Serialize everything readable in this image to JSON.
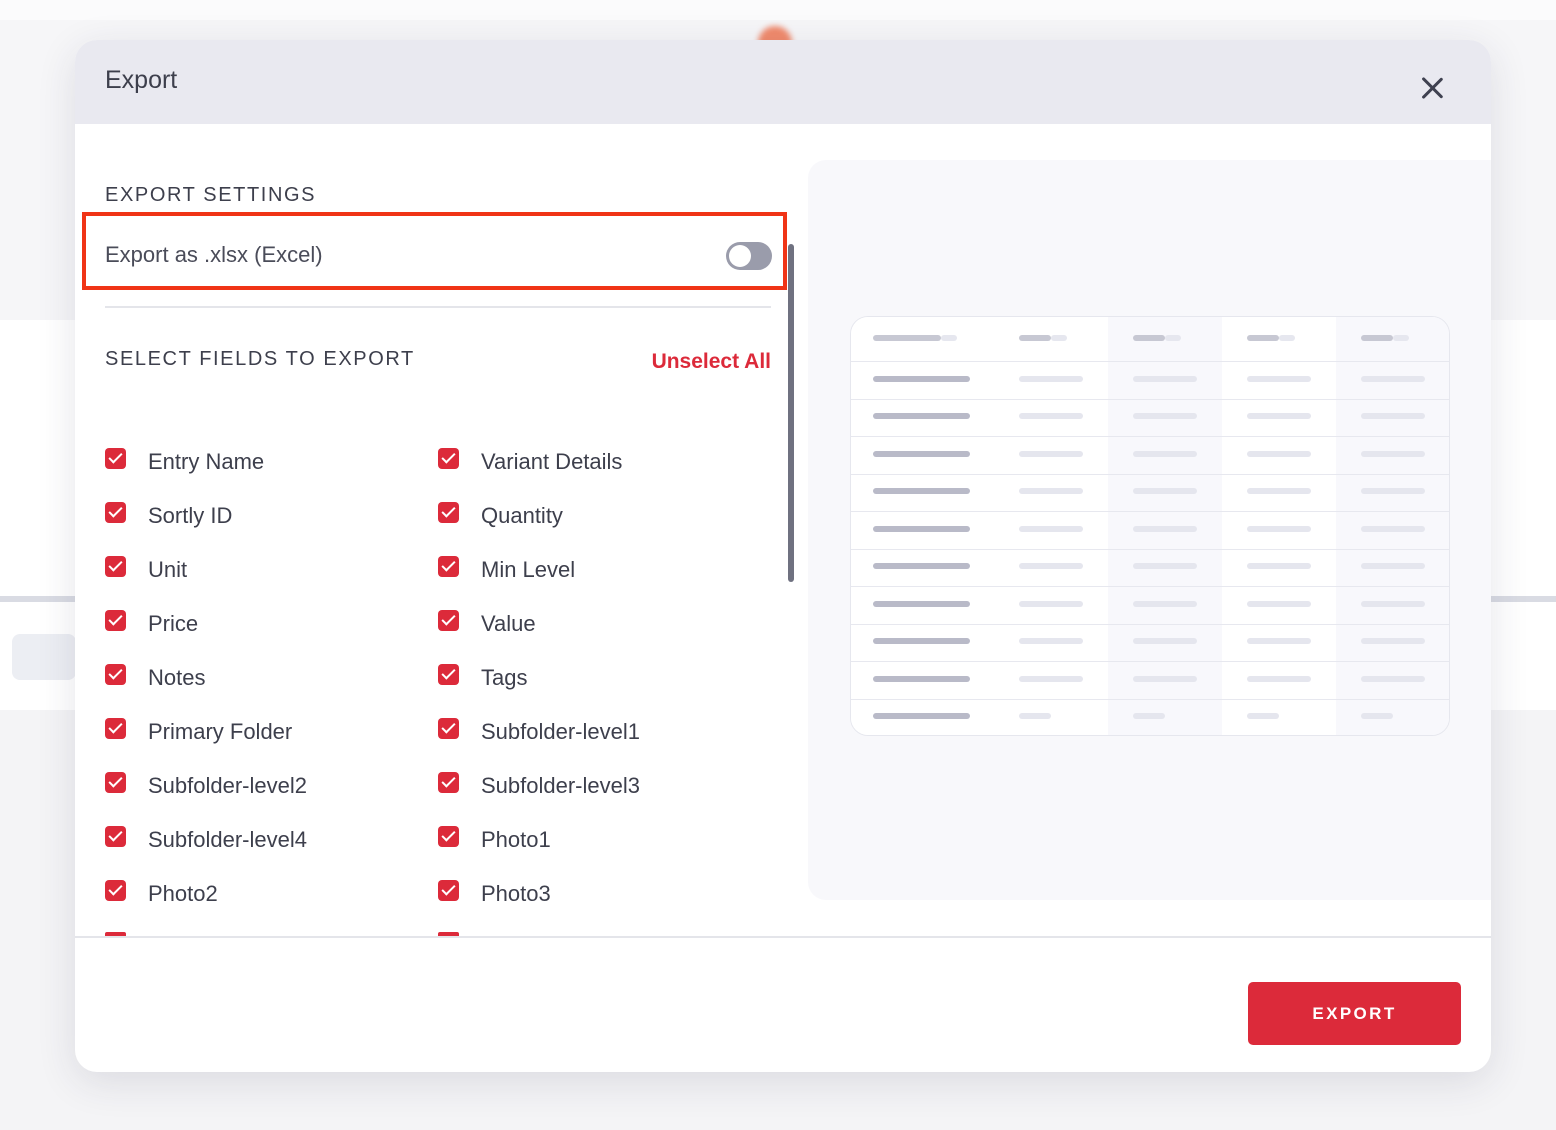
{
  "modal": {
    "title": "Export",
    "close_icon": "close-icon"
  },
  "settings": {
    "section_title": "EXPORT SETTINGS",
    "xlsx_label": "Export as .xlsx (Excel)",
    "xlsx_enabled": false
  },
  "fields_section": {
    "title": "SELECT FIELDS TO EXPORT",
    "unselect_all_label": "Unselect All",
    "fields": [
      {
        "label": "Entry Name",
        "checked": true
      },
      {
        "label": "Variant Details",
        "checked": true
      },
      {
        "label": "Sortly ID",
        "checked": true
      },
      {
        "label": "Quantity",
        "checked": true
      },
      {
        "label": "Unit",
        "checked": true
      },
      {
        "label": "Min Level",
        "checked": true
      },
      {
        "label": "Price",
        "checked": true
      },
      {
        "label": "Value",
        "checked": true
      },
      {
        "label": "Notes",
        "checked": true
      },
      {
        "label": "Tags",
        "checked": true
      },
      {
        "label": "Primary Folder",
        "checked": true
      },
      {
        "label": "Subfolder-level1",
        "checked": true
      },
      {
        "label": "Subfolder-level2",
        "checked": true
      },
      {
        "label": "Subfolder-level3",
        "checked": true
      },
      {
        "label": "Subfolder-level4",
        "checked": true
      },
      {
        "label": "Photo1",
        "checked": true
      },
      {
        "label": "Photo2",
        "checked": true
      },
      {
        "label": "Photo3",
        "checked": true
      }
    ]
  },
  "footer": {
    "export_label": "EXPORT"
  },
  "colors": {
    "accent": "#dc2a3a",
    "highlight": "#f03416",
    "header_bg": "#e9e9f0"
  }
}
